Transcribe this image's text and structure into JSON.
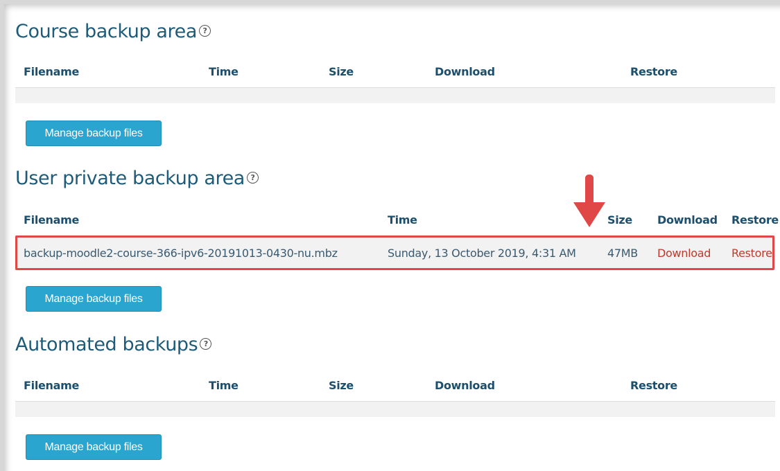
{
  "course_backup": {
    "title": "Course backup area",
    "headers": [
      "Filename",
      "Time",
      "Size",
      "Download",
      "Restore"
    ],
    "manage_button": "Manage backup files"
  },
  "user_backup": {
    "title": "User private backup area",
    "headers": [
      "Filename",
      "Time",
      "Size",
      "Download",
      "Restore"
    ],
    "rows": [
      {
        "filename": "backup-moodle2-course-366-ipv6-20191013-0430-nu.mbz",
        "time": "Sunday, 13 October 2019, 4:31 AM",
        "size": "47MB",
        "download": "Download",
        "restore": "Restore"
      }
    ],
    "manage_button": "Manage backup files"
  },
  "automated_backup": {
    "title": "Automated backups",
    "headers": [
      "Filename",
      "Time",
      "Size",
      "Download",
      "Restore"
    ],
    "manage_button": "Manage backup files"
  },
  "help_icon": "question-circle-icon",
  "annotation": {
    "highlight_color": "#e04848",
    "arrow_icon": "down-arrow-icon"
  },
  "colors": {
    "heading": "#1d5b78",
    "button": "#2aa5cf",
    "link": "#c0392b"
  }
}
